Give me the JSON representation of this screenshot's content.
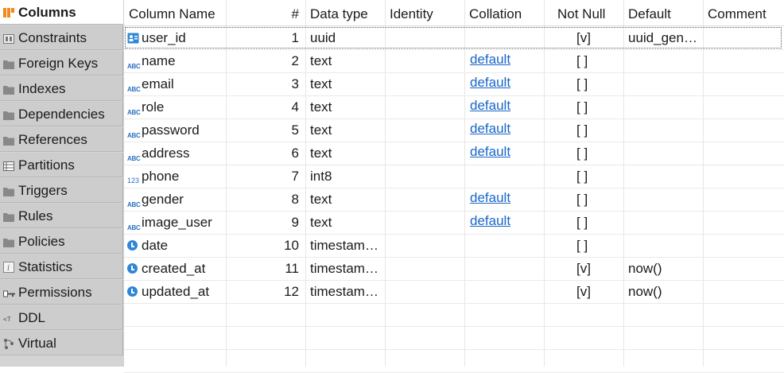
{
  "tabs": [
    {
      "label": "Columns",
      "icon": "columns-icon",
      "active": true
    },
    {
      "label": "Constraints",
      "icon": "constraints-icon",
      "active": false
    },
    {
      "label": "Foreign Keys",
      "icon": "folder-icon",
      "active": false
    },
    {
      "label": "Indexes",
      "icon": "folder-icon",
      "active": false
    },
    {
      "label": "Dependencies",
      "icon": "folder-icon",
      "active": false
    },
    {
      "label": "References",
      "icon": "folder-icon",
      "active": false
    },
    {
      "label": "Partitions",
      "icon": "partitions-icon",
      "active": false
    },
    {
      "label": "Triggers",
      "icon": "folder-icon",
      "active": false
    },
    {
      "label": "Rules",
      "icon": "folder-icon",
      "active": false
    },
    {
      "label": "Policies",
      "icon": "folder-icon",
      "active": false
    },
    {
      "label": "Statistics",
      "icon": "info-icon",
      "active": false
    },
    {
      "label": "Permissions",
      "icon": "key-icon",
      "active": false
    },
    {
      "label": "DDL",
      "icon": "ddl-icon",
      "active": false
    },
    {
      "label": "Virtual",
      "icon": "virtual-icon",
      "active": false
    }
  ],
  "headers": {
    "column_name": "Column Name",
    "num": "#",
    "data_type": "Data type",
    "identity": "Identity",
    "collation": "Collation",
    "not_null": "Not Null",
    "default": "Default",
    "comment": "Comment"
  },
  "rows": [
    {
      "name": "user_id",
      "num": "1",
      "type": "uuid",
      "collation": "",
      "not_null": "[v]",
      "default": "uuid_gen…",
      "type_icon": "uuid-key-icon"
    },
    {
      "name": "name",
      "num": "2",
      "type": "text",
      "collation": "default",
      "not_null": "[ ]",
      "default": "",
      "type_icon": "abc-text-icon"
    },
    {
      "name": "email",
      "num": "3",
      "type": "text",
      "collation": "default",
      "not_null": "[ ]",
      "default": "",
      "type_icon": "abc-text-icon"
    },
    {
      "name": "role",
      "num": "4",
      "type": "text",
      "collation": "default",
      "not_null": "[ ]",
      "default": "",
      "type_icon": "abc-text-icon"
    },
    {
      "name": "password",
      "num": "5",
      "type": "text",
      "collation": "default",
      "not_null": "[ ]",
      "default": "",
      "type_icon": "abc-text-icon"
    },
    {
      "name": "address",
      "num": "6",
      "type": "text",
      "collation": "default",
      "not_null": "[ ]",
      "default": "",
      "type_icon": "abc-text-icon"
    },
    {
      "name": "phone",
      "num": "7",
      "type": "int8",
      "collation": "",
      "not_null": "[ ]",
      "default": "",
      "type_icon": "numeric-123-icon"
    },
    {
      "name": "gender",
      "num": "8",
      "type": "text",
      "collation": "default",
      "not_null": "[ ]",
      "default": "",
      "type_icon": "abc-text-icon"
    },
    {
      "name": "image_user",
      "num": "9",
      "type": "text",
      "collation": "default",
      "not_null": "[ ]",
      "default": "",
      "type_icon": "abc-text-icon"
    },
    {
      "name": "date",
      "num": "10",
      "type": "timestam…",
      "collation": "",
      "not_null": "[ ]",
      "default": "",
      "type_icon": "clock-icon"
    },
    {
      "name": "created_at",
      "num": "11",
      "type": "timestam…",
      "collation": "",
      "not_null": "[v]",
      "default": "now()",
      "type_icon": "clock-icon"
    },
    {
      "name": "updated_at",
      "num": "12",
      "type": "timestam…",
      "collation": "",
      "not_null": "[v]",
      "default": "now()",
      "type_icon": "clock-icon"
    }
  ],
  "colors": {
    "link": "#1a66c9",
    "icon_blue": "#2a6fc2",
    "tab_bg": "#cdcdcd"
  }
}
